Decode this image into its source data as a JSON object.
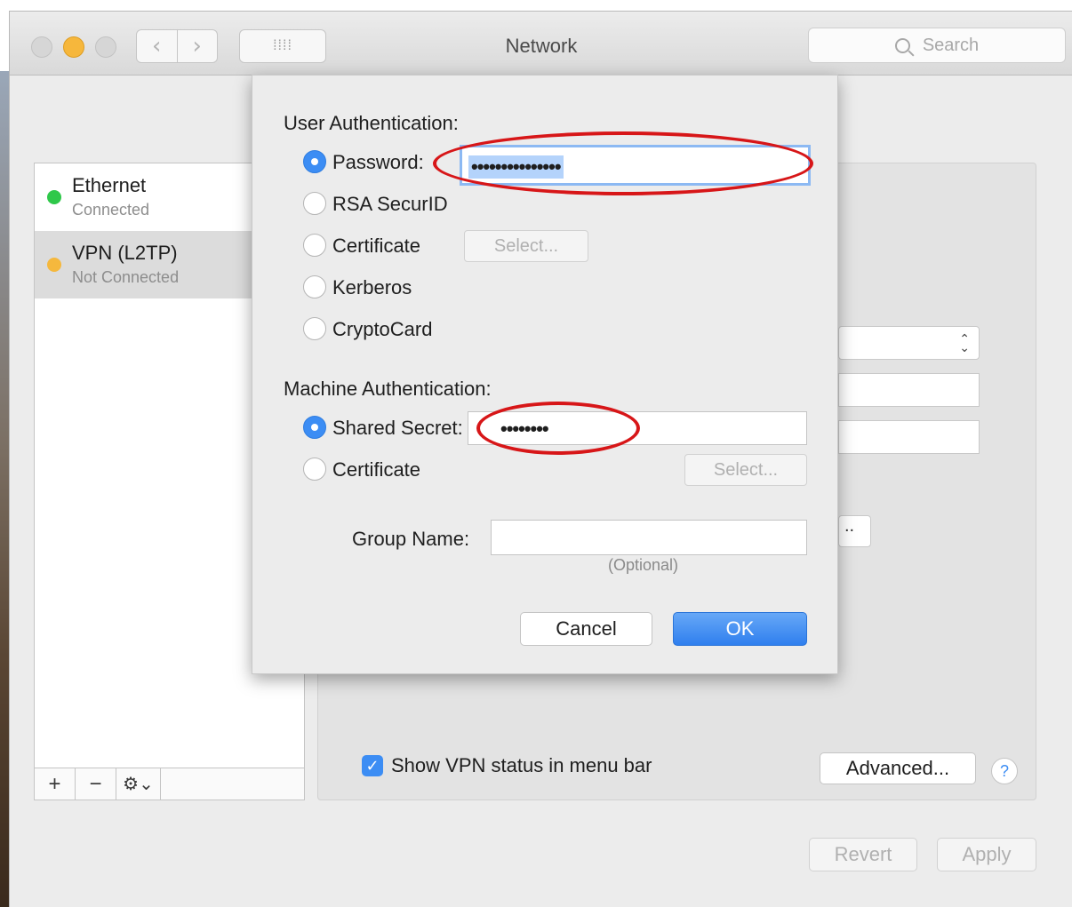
{
  "window": {
    "title": "Network"
  },
  "toolbar": {
    "back_glyph": "‹",
    "forward_glyph": "›",
    "show_all_glyph": "⁞⁞⁞⁞",
    "search_placeholder": "Search",
    "search_icon": "magnifier-icon"
  },
  "sidebar": {
    "services": [
      {
        "name": "Ethernet",
        "status": "Connected",
        "status_color": "#2fc84a"
      },
      {
        "name": "VPN (L2TP)",
        "status": "Not Connected",
        "status_color": "#f5b83d",
        "selected": true
      }
    ],
    "tools": {
      "add": "+",
      "remove": "−",
      "gear": "⚙⌄"
    }
  },
  "auth_sheet": {
    "user_auth_title": "User Authentication:",
    "user_options": [
      "Password:",
      "RSA SecurID",
      "Certificate",
      "Kerberos",
      "CryptoCard"
    ],
    "user_selected": "Password:",
    "password_value": "•••••••••••••••",
    "certificate_select": "Select...",
    "machine_auth_title": "Machine Authentication:",
    "machine_options": [
      "Shared Secret:",
      "Certificate"
    ],
    "machine_selected": "Shared Secret:",
    "shared_secret_value": "••••••••",
    "machine_certificate_select": "Select...",
    "group_name_label": "Group Name:",
    "group_name_value": "",
    "group_name_hint": "(Optional)",
    "cancel": "Cancel",
    "ok": "OK"
  },
  "background_panel": {
    "partial_button_text": "..",
    "show_vpn_status": "Show VPN status in menu bar",
    "show_vpn_checked": true,
    "advanced": "Advanced...",
    "help": "?"
  },
  "footer": {
    "revert": "Revert",
    "apply": "Apply"
  },
  "colors": {
    "accent": "#3c8df4",
    "annotation": "#d71618"
  }
}
